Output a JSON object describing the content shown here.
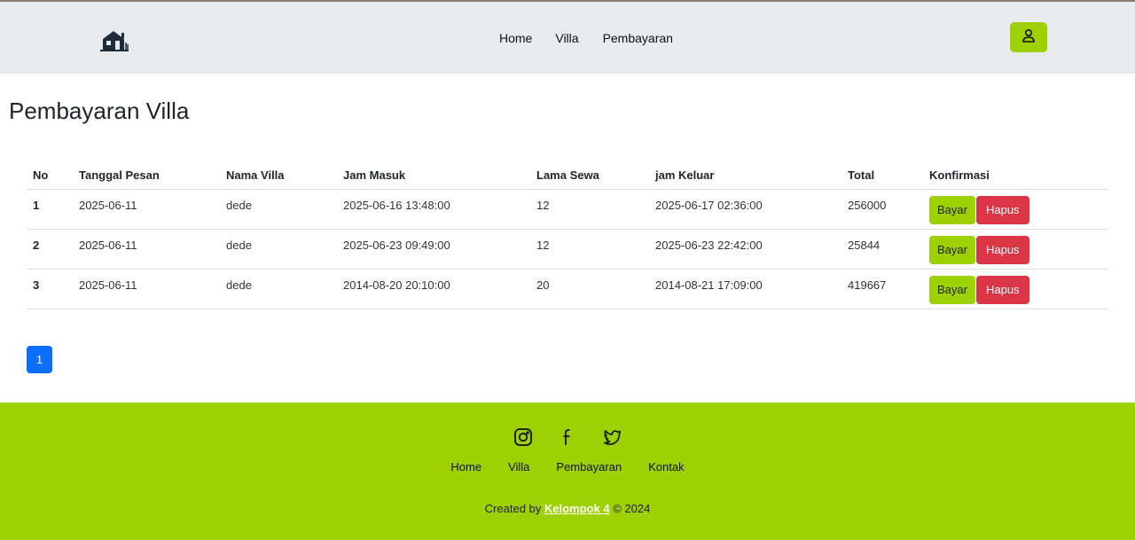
{
  "nav": {
    "links": [
      "Home",
      "Villa",
      "Pembayaran"
    ],
    "user_icon": "user-icon",
    "logo_icon": "villa-logo-icon"
  },
  "page": {
    "title": "Pembayaran Villa"
  },
  "table": {
    "headers": [
      "No",
      "Tanggal Pesan",
      "Nama Villa",
      "Jam Masuk",
      "Lama Sewa",
      "jam Keluar",
      "Total",
      "Konfirmasi"
    ],
    "rows": [
      {
        "no": "1",
        "tanggal": "2025-06-11",
        "nama": "dede",
        "masuk": "2025-06-16 13:48:00",
        "lama": "12",
        "keluar": "2025-06-17 02:36:00",
        "total": "256000"
      },
      {
        "no": "2",
        "tanggal": "2025-06-11",
        "nama": "dede",
        "masuk": "2025-06-23 09:49:00",
        "lama": "12",
        "keluar": "2025-06-23 22:42:00",
        "total": "25844"
      },
      {
        "no": "3",
        "tanggal": "2025-06-11",
        "nama": "dede",
        "masuk": "2014-08-20 20:10:00",
        "lama": "20",
        "keluar": "2014-08-21 17:09:00",
        "total": "419667"
      }
    ],
    "bayar_label": "Bayar",
    "hapus_label": "Hapus"
  },
  "pagination": {
    "current": "1"
  },
  "footer": {
    "social": [
      "instagram-icon",
      "facebook-icon",
      "twitter-icon"
    ],
    "links": [
      "Home",
      "Villa",
      "Pembayaran",
      "Kontak"
    ],
    "credit_prefix": "Created by",
    "credit_brand": "Kelompok 4",
    "credit_suffix": "© 2024"
  },
  "colors": {
    "accent": "#9dd102",
    "danger": "#dc3545",
    "primary": "#0d6efd",
    "navbar": "#e8ebee"
  }
}
